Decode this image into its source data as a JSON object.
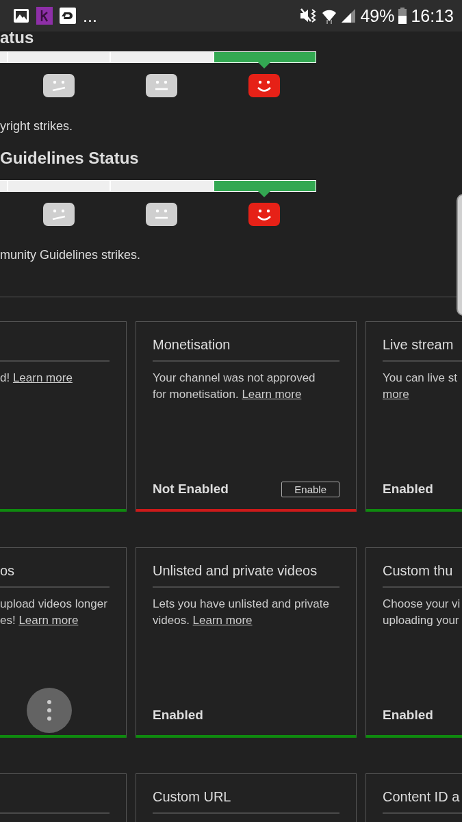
{
  "status_bar": {
    "more": "...",
    "battery": "49%",
    "time": "16:13"
  },
  "strike_sections": [
    {
      "title": "atus",
      "segments": [
        {
          "selected": false
        },
        {
          "selected": false
        },
        {
          "selected": false
        },
        {
          "selected": true
        }
      ],
      "faces": [
        {
          "kind": "sad",
          "selected": false
        },
        {
          "kind": "neutral",
          "selected": false
        },
        {
          "kind": "happy",
          "selected": true
        }
      ],
      "note": "yright strikes."
    },
    {
      "title": "Guidelines Status",
      "segments": [
        {
          "selected": false
        },
        {
          "selected": false
        },
        {
          "selected": false
        },
        {
          "selected": true
        }
      ],
      "faces": [
        {
          "kind": "sad",
          "selected": false
        },
        {
          "kind": "neutral",
          "selected": false
        },
        {
          "kind": "happy",
          "selected": true
        }
      ],
      "note": "munity Guidelines strikes."
    }
  ],
  "feature_rows": [
    [
      {
        "lines": [
          [
            {
              "text": "d! "
            },
            {
              "text": "Learn more",
              "link": true
            }
          ]
        ],
        "enabled": true
      },
      {
        "title": "Monetisation",
        "lines": [
          [
            {
              "text": "Your channel was not approved"
            }
          ],
          [
            {
              "text": "for monetisation. "
            },
            {
              "text": "Learn more",
              "link": true
            }
          ]
        ],
        "status": "Not Enabled",
        "button": "Enable",
        "enabled": false
      },
      {
        "title": "Live stream",
        "lines": [
          [
            {
              "text": "You can live st"
            }
          ],
          [
            {
              "text": "more",
              "link": true
            }
          ]
        ],
        "status": "Enabled",
        "enabled": true
      }
    ],
    [
      {
        "title": "os",
        "lines": [
          [
            {
              "text": "upload videos longer"
            }
          ],
          [
            {
              "text": "es! "
            },
            {
              "text": "Learn more",
              "link": true
            }
          ]
        ],
        "enabled": true
      },
      {
        "title": "Unlisted and private videos",
        "lines": [
          [
            {
              "text": "Lets you have unlisted and private"
            }
          ],
          [
            {
              "text": "videos. "
            },
            {
              "text": "Learn more",
              "link": true
            }
          ]
        ],
        "status": "Enabled",
        "enabled": true
      },
      {
        "title": "Custom thu",
        "lines": [
          [
            {
              "text": "Choose your vi"
            }
          ],
          [
            {
              "text": "uploading your"
            }
          ]
        ],
        "status": "Enabled",
        "enabled": true
      }
    ],
    [
      {},
      {
        "title": "Custom URL"
      },
      {
        "title": "Content ID a"
      }
    ]
  ]
}
